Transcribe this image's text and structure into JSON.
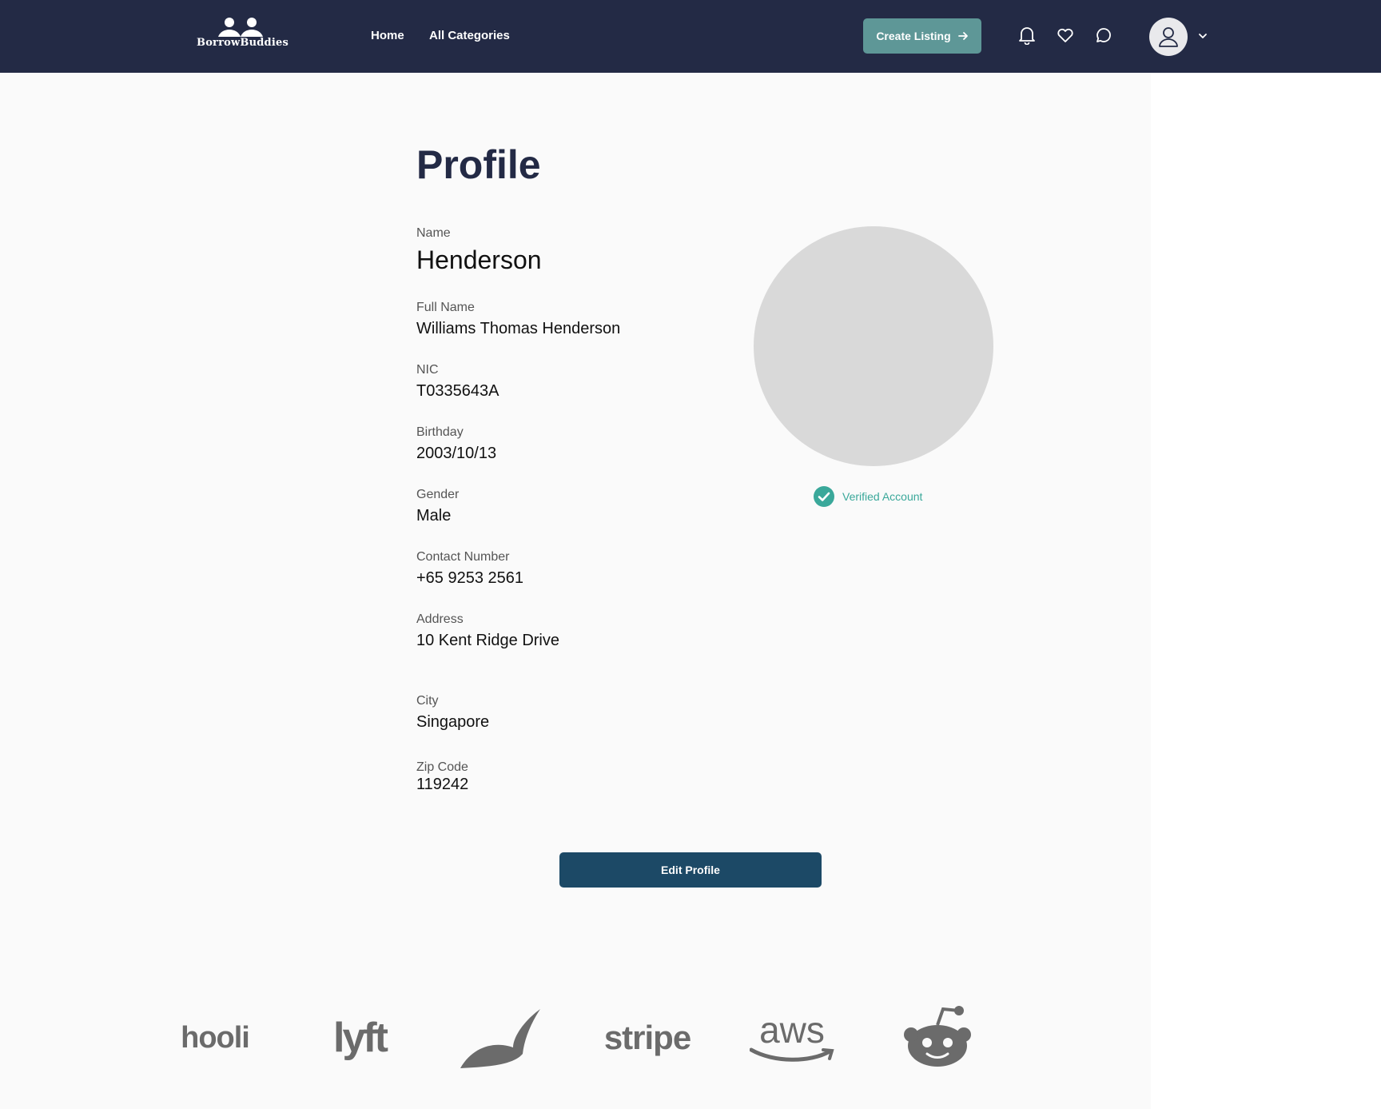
{
  "nav": {
    "logo_text": "BorrowBuddies",
    "links": [
      "Home",
      "All Categories"
    ],
    "create_listing_label": "Create Listing"
  },
  "page": {
    "title": "Profile"
  },
  "profile": {
    "fields": [
      {
        "label": "Name",
        "value": "Henderson"
      },
      {
        "label": "Full Name",
        "value": "Williams Thomas Henderson"
      },
      {
        "label": "NIC",
        "value": "T0335643A"
      },
      {
        "label": "Birthday",
        "value": "2003/10/13"
      },
      {
        "label": "Gender",
        "value": "Male"
      },
      {
        "label": "Contact Number",
        "value": "+65 9253 2561"
      },
      {
        "label": "Address",
        "value": "10 Kent Ridge Drive"
      },
      {
        "label": "City",
        "value": "Singapore"
      },
      {
        "label": "Zip Code",
        "value": "119242"
      }
    ],
    "verified_text": "Verified Account",
    "edit_button_label": "Edit Profile"
  },
  "footer_logos": {
    "hooli": "hooli",
    "lyft": "lyft",
    "stripe": "stripe",
    "aws": "aws"
  },
  "colors": {
    "navbar": "#232a45",
    "accent_teal": "#5e9797",
    "verified_green": "#3aa89a",
    "edit_button": "#1c4966"
  }
}
